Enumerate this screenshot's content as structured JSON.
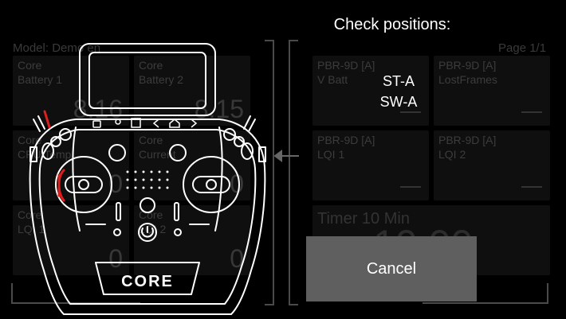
{
  "dashboard": {
    "model_label": "Model: Demo en",
    "page_label": "Page 1/1",
    "left_tiles": [
      {
        "line1": "Core",
        "line2": "Battery 1",
        "value": "8.16"
      },
      {
        "line1": "Core",
        "line2": "Battery 2",
        "value": "8.15"
      },
      {
        "line1": "Core",
        "line2": "CPU Temp.",
        "value": "0"
      },
      {
        "line1": "Core",
        "line2": "Current",
        "value": "0"
      },
      {
        "line1": "Core",
        "line2": "LQI 1",
        "value": "0"
      },
      {
        "line1": "Core",
        "line2": "LQI 2",
        "value": "0"
      }
    ],
    "right_tiles": [
      {
        "line1": "PBR-9D [A]",
        "line2": "V Batt"
      },
      {
        "line1": "PBR-9D [A]",
        "line2": "LostFrames"
      },
      {
        "line1": "PBR-9D [A]",
        "line2": "LQI 1"
      },
      {
        "line1": "PBR-9D [A]",
        "line2": "LQI 2"
      }
    ],
    "timer": {
      "title": "Timer 10 Min",
      "value": "10:00"
    }
  },
  "dialog": {
    "title": "Check positions:",
    "positions": [
      "ST-A",
      "SW-A"
    ],
    "cancel_label": "Cancel"
  },
  "transmitter": {
    "logo_text": "CORE",
    "highlight_color": "#e01e1e",
    "outline_color": "#ffffff"
  }
}
